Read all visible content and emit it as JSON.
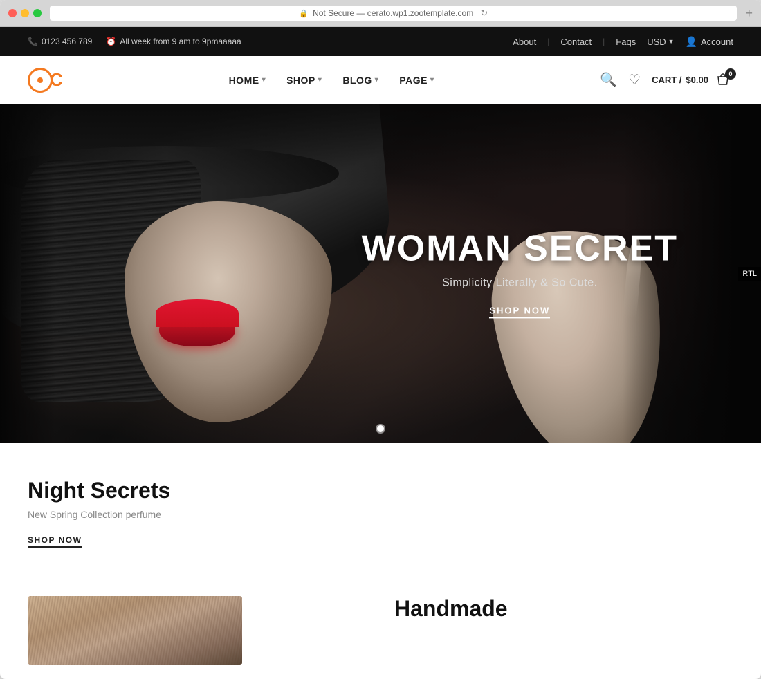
{
  "browser": {
    "address": "Not Secure — cerato.wp1.zootemplate.com",
    "plus_label": "+"
  },
  "topbar": {
    "phone": "0123 456 789",
    "hours": "All week from 9 am to 9pmaaaaa",
    "phone_icon": "📞",
    "clock_icon": "🕐",
    "links": [
      "About",
      "Contact",
      "Faqs"
    ],
    "currency": "USD",
    "currency_chevron": "▼",
    "account_icon": "👤",
    "account_label": "Account"
  },
  "nav": {
    "logo_letter": "C",
    "links": [
      {
        "label": "HOME",
        "has_dropdown": true
      },
      {
        "label": "SHOP",
        "has_dropdown": true
      },
      {
        "label": "BLOG",
        "has_dropdown": true
      },
      {
        "label": "PAGE",
        "has_dropdown": true
      }
    ],
    "search_icon": "🔍",
    "wishlist_icon": "♡",
    "cart_label": "CART /",
    "cart_price": "$0.00",
    "cart_count": "0"
  },
  "hero": {
    "title": "WOMAN SECRET",
    "subtitle": "Simplicity Literally & So Cute.",
    "cta_label": "SHOP NOW",
    "rtl_label": "RTL",
    "dot_count": 1
  },
  "section": {
    "title": "Night Secrets",
    "subtitle": "New Spring Collection perfume",
    "cta_label": "SHOP NOW"
  },
  "handmade": {
    "title": "Handmade"
  }
}
